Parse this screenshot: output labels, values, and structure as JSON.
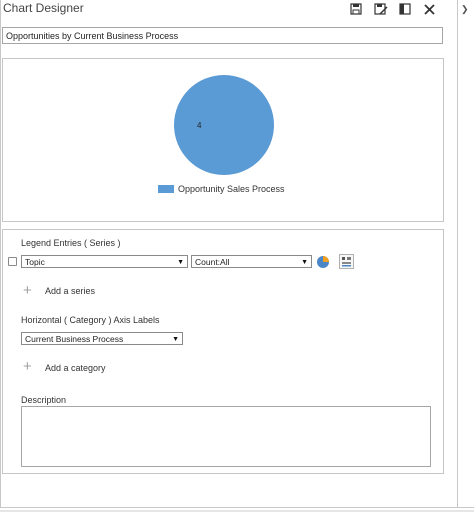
{
  "window": {
    "title": "Chart Designer"
  },
  "toolbar": {
    "save_icon": "save-icon",
    "save_close_icon": "save-close-icon",
    "layout_icon": "layout-icon",
    "close_icon": "close-icon",
    "expand_icon": "chevron-right-icon"
  },
  "chart_name": {
    "value": "Opportunities by Current Business Process"
  },
  "chart_data": {
    "type": "pie",
    "categories": [
      "Opportunity Sales Process"
    ],
    "values": [
      4
    ],
    "data_labels": [
      "4"
    ],
    "legend": [
      "Opportunity Sales Process"
    ],
    "legend_position": "bottom",
    "colors": [
      "#5b9bd5"
    ],
    "title": ""
  },
  "series": {
    "header": "Legend Entries ( Series )",
    "field": "Topic",
    "aggregate": "Count:All",
    "add_label": "Add a series"
  },
  "category": {
    "header": "Horizontal ( Category ) Axis Labels",
    "field": "Current Business Process",
    "add_label": "Add a category"
  },
  "description": {
    "label": "Description",
    "value": ""
  },
  "colors": {
    "pie": "#5b9bd5",
    "frame": "#c6c6c6"
  }
}
